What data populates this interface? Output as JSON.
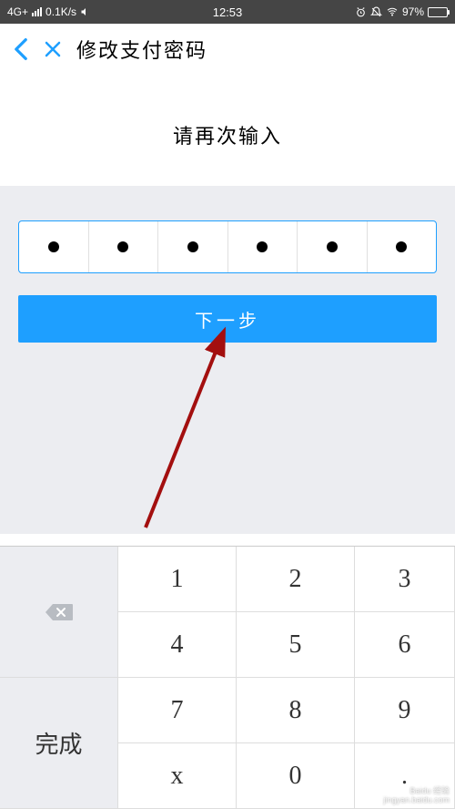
{
  "status": {
    "network": "4G+",
    "speed": "0.1K/s",
    "time": "12:53",
    "battery_pct": "97%"
  },
  "nav": {
    "title": "修改支付密码"
  },
  "prompt": {
    "text": "请再次输入"
  },
  "pin": {
    "length": 6,
    "filled": 6
  },
  "actions": {
    "next_label": "下一步"
  },
  "keypad": {
    "keys": [
      "1",
      "2",
      "3",
      "4",
      "5",
      "6",
      "7",
      "8",
      "9",
      "x",
      "0",
      "."
    ],
    "done_label": "完成"
  },
  "watermark": {
    "line1": "Baidu 经验",
    "line2": "jingyan.baidu.com"
  }
}
